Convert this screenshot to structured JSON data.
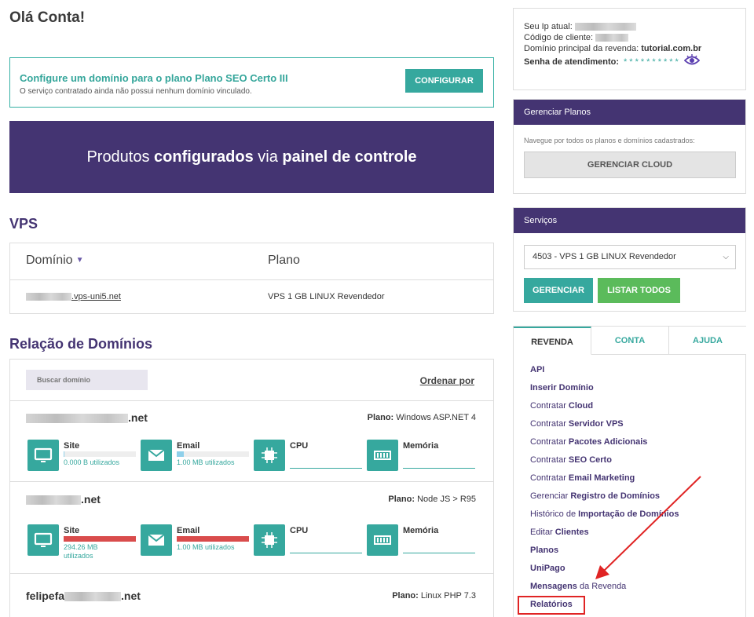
{
  "greeting": "Olá Conta!",
  "config": {
    "title": "Configure um domínio para o plano Plano SEO Certo III",
    "subtitle": "O serviço contratado ainda não possui nenhum domínio vinculado.",
    "button": "CONFIGURAR"
  },
  "banner": {
    "part1": "Produtos ",
    "bold1": "configurados",
    "part2": " via ",
    "bold2": "painel de controle"
  },
  "vps": {
    "title": "VPS",
    "col_domain": "Domínio",
    "col_plan": "Plano",
    "row": {
      "domain_suffix": ".vps-uni5.net",
      "plan": "VPS 1 GB LINUX Revendedor"
    }
  },
  "domains": {
    "title": "Relação de Domínios",
    "search_placeholder": "Buscar domínio",
    "order_by": "Ordenar por",
    "plan_label": "Plano:",
    "items": [
      {
        "name_suffix": ".net",
        "plan": "Windows ASP.NET 4",
        "site_label": "Site",
        "site_used": "0.000 B utilizados",
        "site_fill": 0.01,
        "email_label": "Email",
        "email_used": "1.00 MB utilizados",
        "email_fill": 0.1,
        "cpu_label": "CPU",
        "mem_label": "Memória"
      },
      {
        "name_suffix": ".net",
        "plan": "Node JS > R95",
        "site_label": "Site",
        "site_used": "294.26 MB utilizados",
        "site_fill": 1.0,
        "email_label": "Email",
        "email_used": "1.00 MB utilizados",
        "email_fill": 1.0,
        "cpu_label": "CPU",
        "mem_label": "Memória"
      },
      {
        "name_prefix": "felipefa",
        "name_suffix": ".net",
        "plan": "Linux PHP 7.3"
      }
    ]
  },
  "info": {
    "ip_label": "Seu Ip atual:",
    "client_label": "Código de cliente:",
    "domain_label": "Domínio principal da revenda:",
    "domain_value": "tutorial.com.br",
    "password_label": "Senha de atendimento:",
    "password_mask": "**********"
  },
  "plans_panel": {
    "title": "Gerenciar Planos",
    "desc": "Navegue por todos os planos e domínios cadastrados:",
    "button": "GERENCIAR CLOUD"
  },
  "services": {
    "title": "Serviços",
    "selected": "4503 - VPS 1 GB LINUX Revendedor",
    "btn_manage": "GERENCIAR",
    "btn_list": "LISTAR TODOS"
  },
  "tabs": [
    "REVENDA",
    "CONTA",
    "AJUDA"
  ],
  "menu": [
    {
      "pre": "",
      "bold": "API",
      "post": ""
    },
    {
      "pre": "",
      "bold": "Inserir Domínio",
      "post": ""
    },
    {
      "pre": "Contratar ",
      "bold": "Cloud",
      "post": ""
    },
    {
      "pre": "Contratar ",
      "bold": "Servidor VPS",
      "post": ""
    },
    {
      "pre": "Contratar ",
      "bold": "Pacotes Adicionais",
      "post": ""
    },
    {
      "pre": "Contratar ",
      "bold": "SEO Certo",
      "post": ""
    },
    {
      "pre": "Contratar ",
      "bold": "Email Marketing",
      "post": ""
    },
    {
      "pre": "Gerenciar ",
      "bold": "Registro de Domínios",
      "post": ""
    },
    {
      "pre": "Histórico de ",
      "bold": "Importação de Domínios",
      "post": ""
    },
    {
      "pre": "Editar ",
      "bold": "Clientes",
      "post": ""
    },
    {
      "pre": "",
      "bold": "Planos",
      "post": ""
    },
    {
      "pre": "",
      "bold": "UniPago",
      "post": ""
    },
    {
      "pre": "",
      "bold": "Mensagens",
      "post": " da Revenda"
    },
    {
      "pre": "",
      "bold": "Relatórios",
      "post": ""
    }
  ],
  "colors": {
    "purple": "#443472",
    "teal": "#36a89e",
    "green": "#5bbb5b",
    "red": "#d94c4c"
  }
}
